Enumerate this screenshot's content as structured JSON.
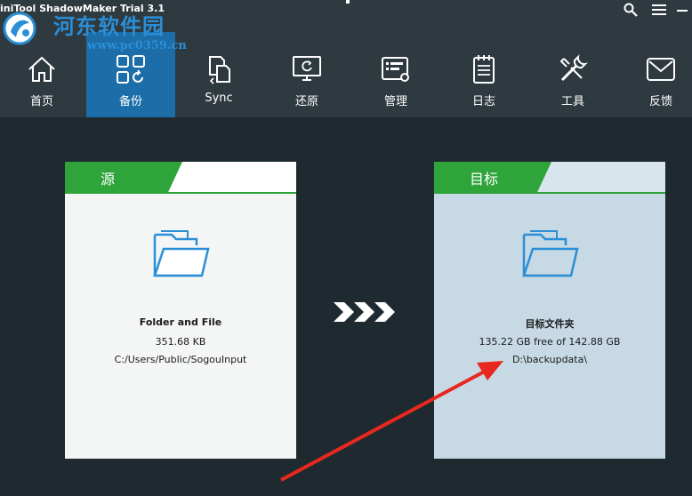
{
  "window": {
    "title": "iniTool ShadowMaker Trial 3.1",
    "watermark_name": "河东软件园",
    "watermark_url": "www.pc0359.cn"
  },
  "toolbar": {
    "items": [
      {
        "label": "首页",
        "icon": "home-icon"
      },
      {
        "label": "备份",
        "icon": "backup-icon",
        "active": true
      },
      {
        "label": "Sync",
        "icon": "sync-icon"
      },
      {
        "label": "还原",
        "icon": "restore-icon"
      },
      {
        "label": "管理",
        "icon": "manage-icon"
      },
      {
        "label": "日志",
        "icon": "log-icon"
      },
      {
        "label": "工具",
        "icon": "tools-icon"
      },
      {
        "label": "反馈",
        "icon": "feedback-icon"
      }
    ]
  },
  "source": {
    "tab_label": "源",
    "name": "Folder and File",
    "size": "351.68 KB",
    "path": "C:/Users/Public/SogouInput"
  },
  "target": {
    "tab_label": "目标",
    "name": "目标文件夹",
    "size": "135.22 GB free of 142.88 GB",
    "path": "D:\\backupdata\\"
  },
  "colors": {
    "accent_green": "#2ea43a",
    "active_blue": "#1c6da8",
    "toolbar_bg": "#2f3a40",
    "page_bg": "#1e2a30",
    "annotation_red": "#e8281e"
  }
}
